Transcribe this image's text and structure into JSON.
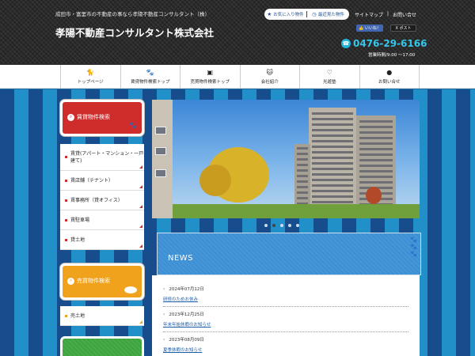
{
  "header": {
    "tagline": "成田市・富里市の不動産の事なら孝陽不動産コンサルタント（株）",
    "title": "孝陽不動産コンサルタント株式会社",
    "favorites_label": "お気に入り物件",
    "recent_label": "最近見た物件",
    "sitemap_label": "サイトマップ",
    "contact_label": "お問い合せ",
    "fb_like_label": "いいね！",
    "tweet_label": "ポスト",
    "phone": "0476-29-6166",
    "hours": "営業時間/9:00 〜17:00"
  },
  "nav": {
    "items": [
      {
        "label": "トップページ",
        "icon": "cat-icon"
      },
      {
        "label": "賃貸物件検索トップ",
        "icon": "paw-icon"
      },
      {
        "label": "売買物件検索トップ",
        "icon": "sale-icon"
      },
      {
        "label": "会社紹介",
        "icon": "cat-face-icon"
      },
      {
        "label": "光遊塾",
        "icon": "heart-icon"
      },
      {
        "label": "お問い合せ",
        "icon": "fish-icon"
      }
    ]
  },
  "sidebar": {
    "rental_title": "賃貸物件検索",
    "rental_items": [
      "賃貸(アパート・マンション・一戸建て)",
      "賃店舗（テナント）",
      "賃事務所（貸オフィス）",
      "賃駐車場",
      "貸土地"
    ],
    "sale_title": "売買物件検索",
    "sale_items": [
      "売土地"
    ]
  },
  "slider": {
    "dot_count": 5,
    "active_index": 1
  },
  "news": {
    "title": "NEWS",
    "items": [
      {
        "date": "2024年07月12日",
        "text": "研修のためお休み"
      },
      {
        "date": "2023年12月25日",
        "text": "年末年始休暇のお知らせ"
      },
      {
        "date": "2023年08月09日",
        "text": "夏季休暇のお知らせ"
      }
    ]
  },
  "colors": {
    "rental_red": "#cf2c2c",
    "sale_orange": "#f0a21c",
    "news_blue": "#3c8fd4",
    "phone_cyan": "#35c6ea",
    "stripe_dark": "#174d8c",
    "stripe_light": "#2190c8"
  }
}
